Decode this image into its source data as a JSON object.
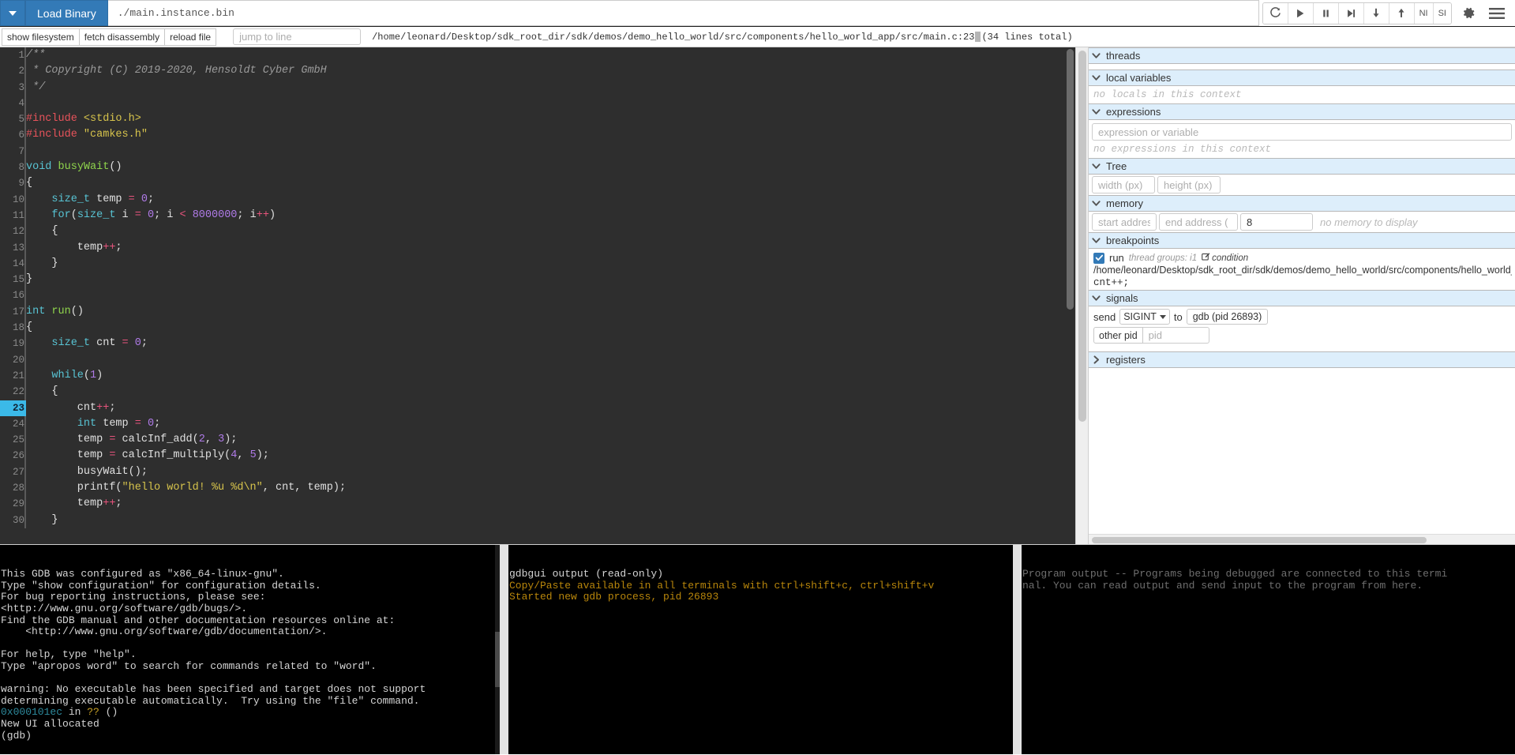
{
  "topbar": {
    "caret_icon": "caret-down-icon",
    "load_binary_label": "Load Binary",
    "binary_value": "./main.instance.bin",
    "controls": [
      {
        "name": "restart-button",
        "icon": "restart-icon"
      },
      {
        "name": "continue-button",
        "icon": "play-icon"
      },
      {
        "name": "pause-button",
        "icon": "pause-icon"
      },
      {
        "name": "next-button",
        "icon": "step-over-icon"
      },
      {
        "name": "step-into-button",
        "icon": "arrow-down-icon"
      },
      {
        "name": "step-out-button",
        "icon": "arrow-up-icon"
      }
    ],
    "ni_label": "NI",
    "si_label": "SI",
    "gear_icon": "gear-icon",
    "menu_icon": "hamburger-menu-icon"
  },
  "secondbar": {
    "show_filesystem": "show filesystem",
    "fetch_disassembly": "fetch disassembly",
    "reload_file": "reload file",
    "jump_to_line_placeholder": "jump to line",
    "jump_to_line_value": "",
    "file_path": "/home/leonard/Desktop/sdk_root_dir/sdk/demos/demo_hello_world/src/components/hello_world_app/src/main.c:23",
    "line_count": "(34 lines total)"
  },
  "editor": {
    "current_line": 23,
    "lines": [
      {
        "n": 1,
        "tokens": [
          {
            "t": "/**",
            "c": "cmt"
          }
        ]
      },
      {
        "n": 2,
        "tokens": [
          {
            "t": " * Copyright (C) 2019-2020, Hensoldt Cyber GmbH",
            "c": "cmt"
          }
        ]
      },
      {
        "n": 3,
        "tokens": [
          {
            "t": " */",
            "c": "cmt"
          }
        ]
      },
      {
        "n": 4,
        "tokens": []
      },
      {
        "n": 5,
        "tokens": [
          {
            "t": "#include ",
            "c": "pre"
          },
          {
            "t": "<stdio.h>",
            "c": "str"
          }
        ]
      },
      {
        "n": 6,
        "tokens": [
          {
            "t": "#include ",
            "c": "pre"
          },
          {
            "t": "\"camkes.h\"",
            "c": "str"
          }
        ]
      },
      {
        "n": 7,
        "tokens": []
      },
      {
        "n": 8,
        "tokens": [
          {
            "t": "void",
            "c": "kw"
          },
          {
            "t": " ",
            "c": "pl"
          },
          {
            "t": "busyWait",
            "c": "fn"
          },
          {
            "t": "()",
            "c": "pl"
          }
        ]
      },
      {
        "n": 9,
        "tokens": [
          {
            "t": "{",
            "c": "pl"
          }
        ]
      },
      {
        "n": 10,
        "tokens": [
          {
            "t": "    ",
            "c": "pl"
          },
          {
            "t": "size_t",
            "c": "typ"
          },
          {
            "t": " temp ",
            "c": "pl"
          },
          {
            "t": "=",
            "c": "op"
          },
          {
            "t": " ",
            "c": "pl"
          },
          {
            "t": "0",
            "c": "num"
          },
          {
            "t": ";",
            "c": "pl"
          }
        ]
      },
      {
        "n": 11,
        "tokens": [
          {
            "t": "    ",
            "c": "pl"
          },
          {
            "t": "for",
            "c": "kw"
          },
          {
            "t": "(",
            "c": "pl"
          },
          {
            "t": "size_t",
            "c": "typ"
          },
          {
            "t": " i ",
            "c": "pl"
          },
          {
            "t": "=",
            "c": "op"
          },
          {
            "t": " ",
            "c": "pl"
          },
          {
            "t": "0",
            "c": "num"
          },
          {
            "t": "; i ",
            "c": "pl"
          },
          {
            "t": "<",
            "c": "op"
          },
          {
            "t": " ",
            "c": "pl"
          },
          {
            "t": "8000000",
            "c": "num"
          },
          {
            "t": "; i",
            "c": "pl"
          },
          {
            "t": "++",
            "c": "op"
          },
          {
            "t": ")",
            "c": "pl"
          }
        ]
      },
      {
        "n": 12,
        "tokens": [
          {
            "t": "    {",
            "c": "pl"
          }
        ]
      },
      {
        "n": 13,
        "tokens": [
          {
            "t": "        temp",
            "c": "pl"
          },
          {
            "t": "++",
            "c": "op"
          },
          {
            "t": ";",
            "c": "pl"
          }
        ]
      },
      {
        "n": 14,
        "tokens": [
          {
            "t": "    }",
            "c": "pl"
          }
        ]
      },
      {
        "n": 15,
        "tokens": [
          {
            "t": "}",
            "c": "pl"
          }
        ]
      },
      {
        "n": 16,
        "tokens": []
      },
      {
        "n": 17,
        "tokens": [
          {
            "t": "int",
            "c": "kw"
          },
          {
            "t": " ",
            "c": "pl"
          },
          {
            "t": "run",
            "c": "fn"
          },
          {
            "t": "()",
            "c": "pl"
          }
        ]
      },
      {
        "n": 18,
        "tokens": [
          {
            "t": "{",
            "c": "pl"
          }
        ]
      },
      {
        "n": 19,
        "tokens": [
          {
            "t": "    ",
            "c": "pl"
          },
          {
            "t": "size_t",
            "c": "typ"
          },
          {
            "t": " cnt ",
            "c": "pl"
          },
          {
            "t": "=",
            "c": "op"
          },
          {
            "t": " ",
            "c": "pl"
          },
          {
            "t": "0",
            "c": "num"
          },
          {
            "t": ";",
            "c": "pl"
          }
        ]
      },
      {
        "n": 20,
        "tokens": []
      },
      {
        "n": 21,
        "tokens": [
          {
            "t": "    ",
            "c": "pl"
          },
          {
            "t": "while",
            "c": "kw"
          },
          {
            "t": "(",
            "c": "pl"
          },
          {
            "t": "1",
            "c": "num"
          },
          {
            "t": ")",
            "c": "pl"
          }
        ]
      },
      {
        "n": 22,
        "tokens": [
          {
            "t": "    {",
            "c": "pl"
          }
        ]
      },
      {
        "n": 23,
        "tokens": [
          {
            "t": "        cnt",
            "c": "pl"
          },
          {
            "t": "++",
            "c": "op"
          },
          {
            "t": ";",
            "c": "pl"
          }
        ]
      },
      {
        "n": 24,
        "tokens": [
          {
            "t": "        ",
            "c": "pl"
          },
          {
            "t": "int",
            "c": "kw"
          },
          {
            "t": " temp ",
            "c": "pl"
          },
          {
            "t": "=",
            "c": "op"
          },
          {
            "t": " ",
            "c": "pl"
          },
          {
            "t": "0",
            "c": "num"
          },
          {
            "t": ";",
            "c": "pl"
          }
        ]
      },
      {
        "n": 25,
        "tokens": [
          {
            "t": "        temp ",
            "c": "pl"
          },
          {
            "t": "=",
            "c": "op"
          },
          {
            "t": " calcInf_add(",
            "c": "pl"
          },
          {
            "t": "2",
            "c": "num"
          },
          {
            "t": ", ",
            "c": "pl"
          },
          {
            "t": "3",
            "c": "num"
          },
          {
            "t": ");",
            "c": "pl"
          }
        ]
      },
      {
        "n": 26,
        "tokens": [
          {
            "t": "        temp ",
            "c": "pl"
          },
          {
            "t": "=",
            "c": "op"
          },
          {
            "t": " calcInf_multiply(",
            "c": "pl"
          },
          {
            "t": "4",
            "c": "num"
          },
          {
            "t": ", ",
            "c": "pl"
          },
          {
            "t": "5",
            "c": "num"
          },
          {
            "t": ");",
            "c": "pl"
          }
        ]
      },
      {
        "n": 27,
        "tokens": [
          {
            "t": "        busyWait();",
            "c": "pl"
          }
        ]
      },
      {
        "n": 28,
        "tokens": [
          {
            "t": "        printf(",
            "c": "pl"
          },
          {
            "t": "\"hello world! %u %d\\n\"",
            "c": "str"
          },
          {
            "t": ", cnt, temp);",
            "c": "pl"
          }
        ]
      },
      {
        "n": 29,
        "tokens": [
          {
            "t": "        temp",
            "c": "pl"
          },
          {
            "t": "++",
            "c": "op"
          },
          {
            "t": ";",
            "c": "pl"
          }
        ]
      },
      {
        "n": 30,
        "tokens": [
          {
            "t": "    }",
            "c": "pl"
          }
        ]
      }
    ]
  },
  "sidebar": {
    "threads": {
      "title": "threads",
      "expanded": true
    },
    "local_variables": {
      "title": "local variables",
      "expanded": true,
      "empty_text": "no locals in this context"
    },
    "expressions": {
      "title": "expressions",
      "expanded": true,
      "input_placeholder": "expression or variable",
      "input_value": "",
      "empty_text": "no expressions in this context"
    },
    "tree": {
      "title": "Tree",
      "expanded": true,
      "width_placeholder": "width (px)",
      "width_value": "",
      "height_placeholder": "height (px)",
      "height_value": ""
    },
    "memory": {
      "title": "memory",
      "expanded": true,
      "start_placeholder": "start address",
      "start_value": "",
      "end_placeholder": "end address (",
      "end_value": "",
      "count_value": "8",
      "empty_text": "no memory to display"
    },
    "breakpoints": {
      "title": "breakpoints",
      "expanded": true,
      "checked": true,
      "function": "run",
      "thread_groups": "thread groups: i1",
      "condition_label": "condition",
      "condition_icon": "edit-square-icon",
      "path": "/home/leonard/Desktop/sdk_root_dir/sdk/demos/demo_hello_world/src/components/hello_world_a",
      "source_line": "cnt++;"
    },
    "signals": {
      "title": "signals",
      "expanded": true,
      "send_label": "send",
      "signal_selected": "SIGINT",
      "to_label": "to",
      "target_label": "gdb (pid 26893)",
      "other_pid_label": "other pid",
      "pid_placeholder": "pid",
      "pid_value": ""
    },
    "registers": {
      "title": "registers",
      "expanded": false
    }
  },
  "consoles": {
    "gdb_terminal": [
      {
        "text": "This GDB was configured as \"x86_64-linux-gnu\".",
        "color": "white"
      },
      {
        "text": "Type \"show configuration\" for configuration details.",
        "color": "white"
      },
      {
        "text": "For bug reporting instructions, please see:",
        "color": "white"
      },
      {
        "text": "<http://www.gnu.org/software/gdb/bugs/>.",
        "color": "white"
      },
      {
        "text": "Find the GDB manual and other documentation resources online at:",
        "color": "white"
      },
      {
        "text": "    <http://www.gnu.org/software/gdb/documentation/>.",
        "color": "white"
      },
      {
        "text": "",
        "color": "white"
      },
      {
        "text": "For help, type \"help\".",
        "color": "white"
      },
      {
        "text": "Type \"apropos word\" to search for commands related to \"word\".",
        "color": "white"
      },
      {
        "text": "",
        "color": "white"
      },
      {
        "text": "warning: No executable has been specified and target does not support",
        "color": "white"
      },
      {
        "text": "determining executable automatically.  Try using the \"file\" command.",
        "color": "white"
      },
      {
        "text": "0x000101ec",
        "color": "cyan",
        "suffix": " in ",
        "suffix2": "??",
        "suffix2_color": "amber",
        "suffix3": " ()"
      },
      {
        "text": "New UI allocated",
        "color": "white"
      },
      {
        "text": "(gdb)",
        "color": "white"
      }
    ],
    "gdbgui_terminal": [
      {
        "text": "gdbgui output (read-only)",
        "color": "white"
      },
      {
        "text": "Copy/Paste available in all terminals with ctrl+shift+c, ctrl+shift+v",
        "color": "yellow"
      },
      {
        "text": "Started new gdb process, pid 26893",
        "color": "yellow"
      }
    ],
    "program_terminal": [
      {
        "text": "Program output -- Programs being debugged are connected to this termi",
        "color": "gray"
      },
      {
        "text": "nal. You can read output and send input to the program from here.",
        "color": "gray"
      }
    ]
  },
  "colors": {
    "accent_blue": "#337ab7",
    "section_header_bg": "#ddeefb",
    "editor_bg": "#2e2e2e",
    "current_line_bg": "#3bb9e8",
    "terminal_bg": "#000000"
  }
}
